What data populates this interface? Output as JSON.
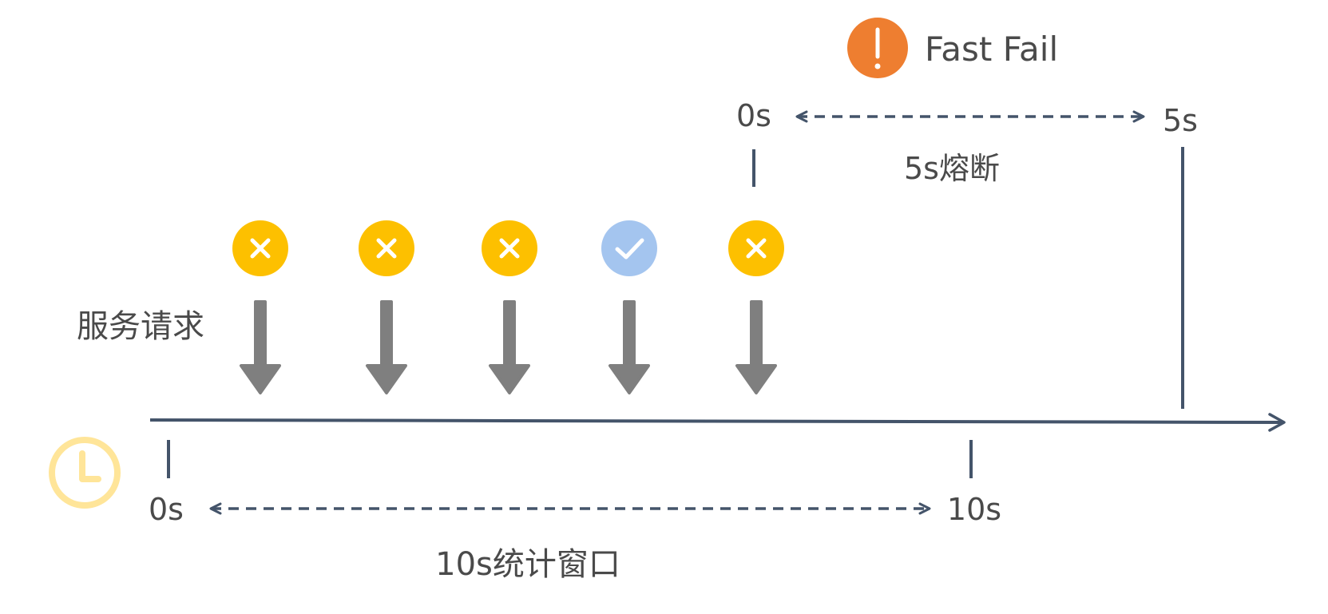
{
  "fast_fail": {
    "label": "Fast Fail",
    "icon": "exclamation-icon",
    "color": "#EE7E30"
  },
  "break_window": {
    "start": "0s",
    "end": "5s",
    "label": "5s熔断"
  },
  "stat_window": {
    "start": "0s",
    "end": "10s",
    "label": "10s统计窗口"
  },
  "requests": {
    "label": "服务请求",
    "items": [
      {
        "status": "fail",
        "icon": "cross-icon"
      },
      {
        "status": "fail",
        "icon": "cross-icon"
      },
      {
        "status": "fail",
        "icon": "cross-icon"
      },
      {
        "status": "success",
        "icon": "check-icon"
      },
      {
        "status": "fail",
        "icon": "cross-icon"
      }
    ]
  },
  "colors": {
    "fail": "#FDC000",
    "success": "#A4C5EF",
    "axis": "#44546A",
    "arrow": "#7F7F7F",
    "clock": "#FFE599"
  }
}
